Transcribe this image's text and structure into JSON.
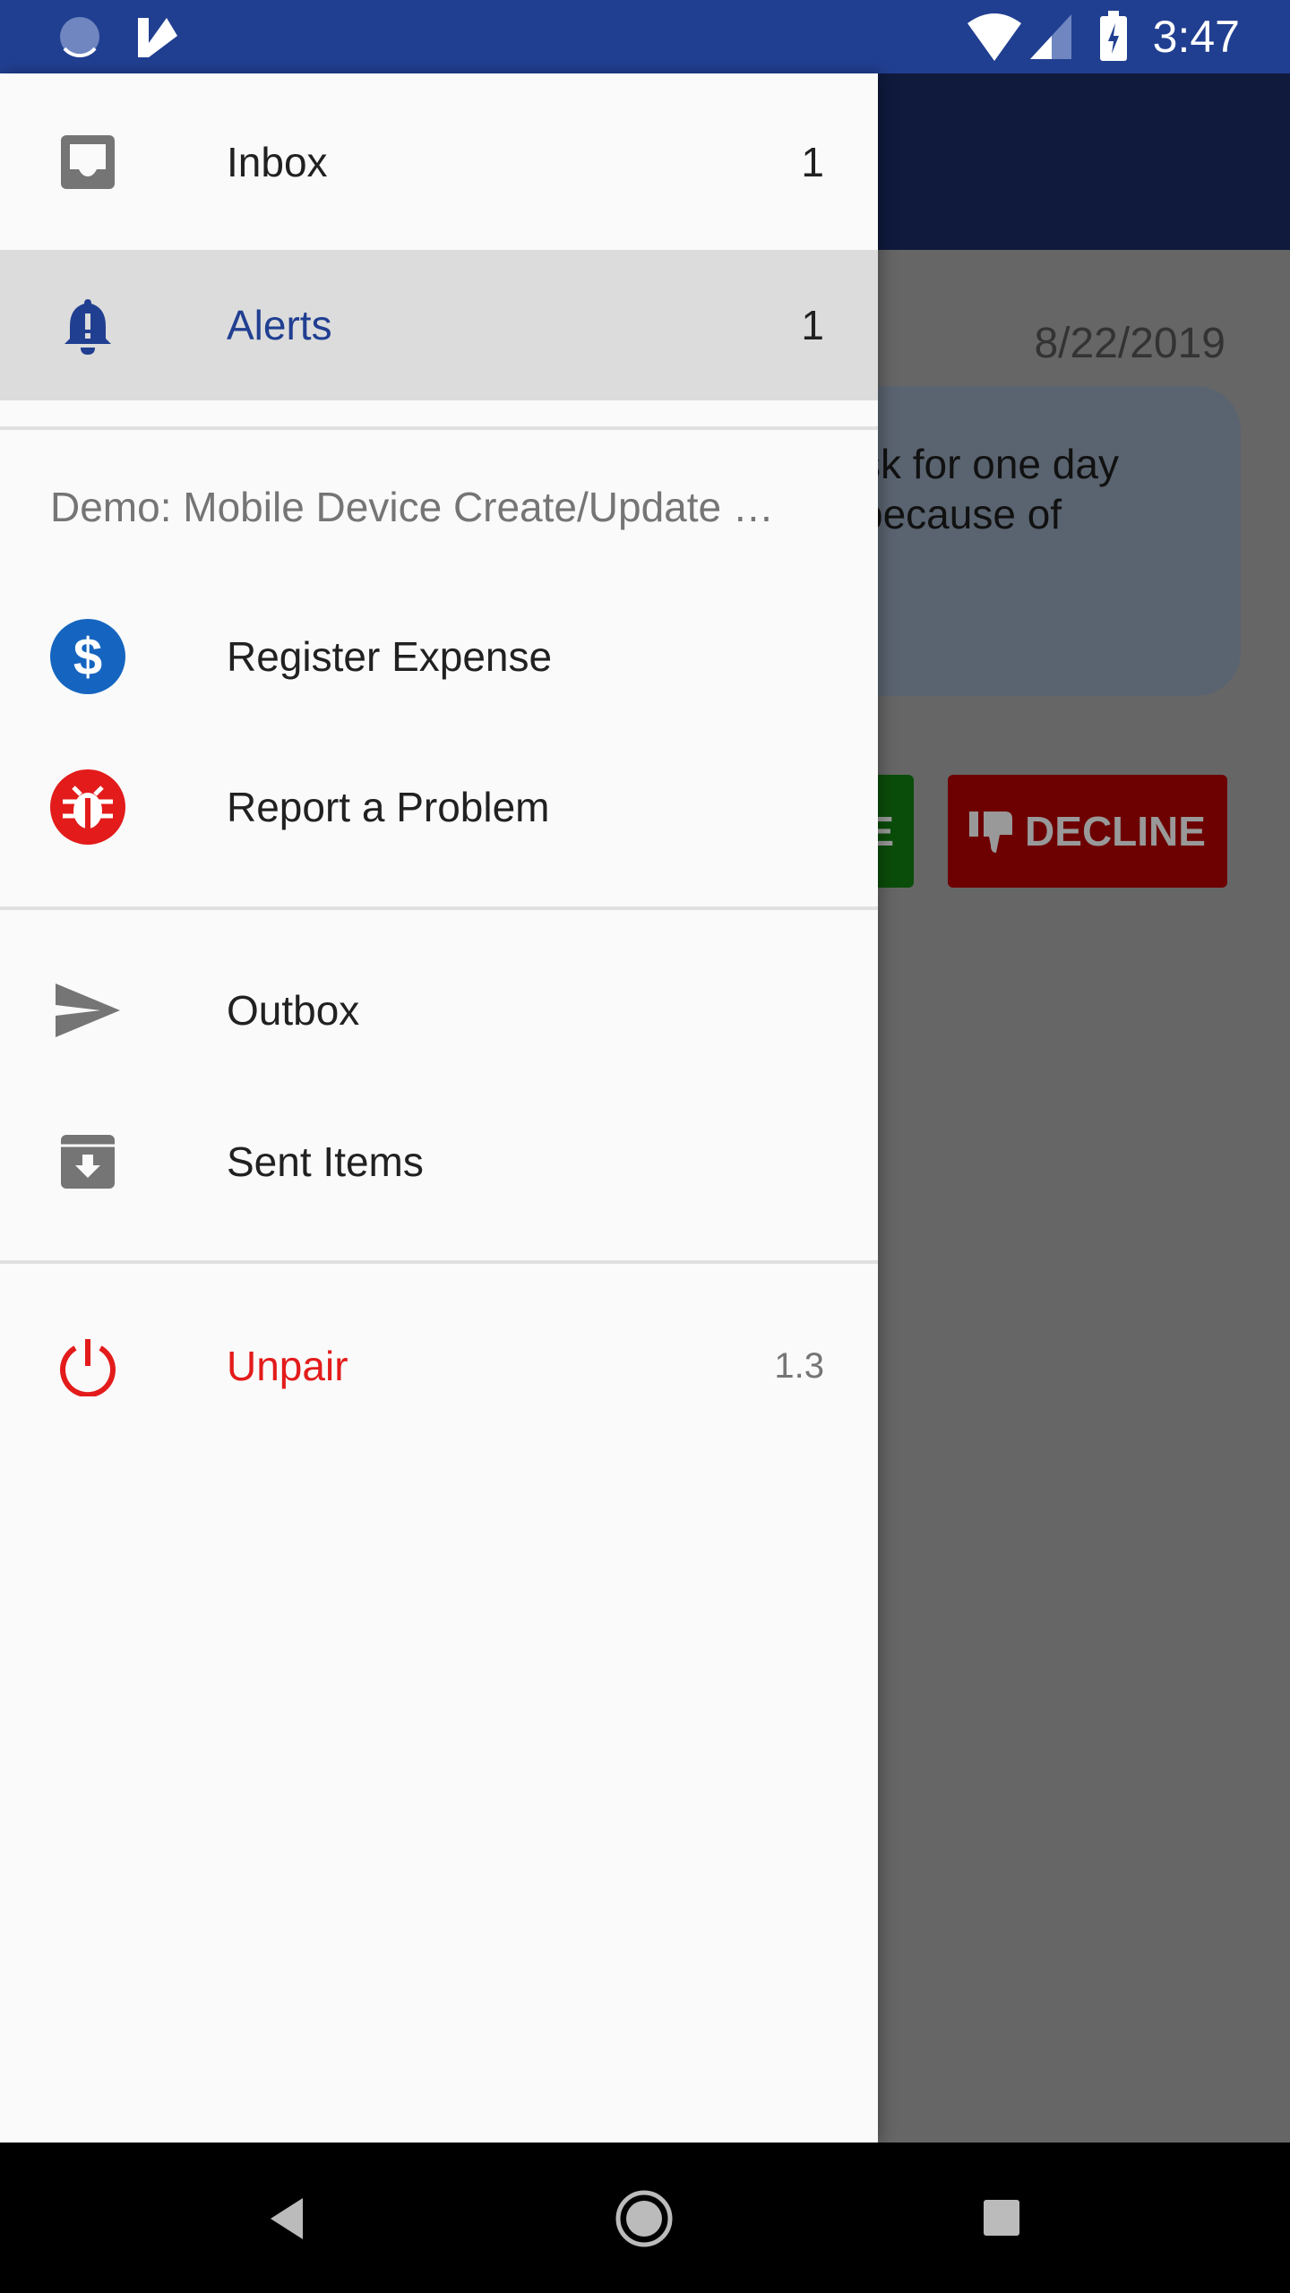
{
  "status_bar": {
    "time": "3:47",
    "icons": [
      "sync-icon",
      "app-check-icon",
      "wifi-icon",
      "signal-icon",
      "battery-charging-icon"
    ]
  },
  "background": {
    "date": "8/22/2019",
    "message_lines": [
      "sk for one day",
      "because of"
    ],
    "approve_fragment": "E",
    "decline_label": "DECLINE"
  },
  "drawer": {
    "inbox": {
      "label": "Inbox",
      "count": "1"
    },
    "alerts": {
      "label": "Alerts",
      "count": "1"
    },
    "section_title": "Demo: Mobile Device Create/Update …",
    "register_expense": {
      "label": "Register Expense"
    },
    "report_problem": {
      "label": "Report a Problem"
    },
    "outbox": {
      "label": "Outbox"
    },
    "sent_items": {
      "label": "Sent Items"
    },
    "unpair": {
      "label": "Unpair",
      "version": "1.3"
    }
  },
  "colors": {
    "accent": "#213f91",
    "danger": "#e31b1b",
    "selected_bg": "#dcdcdc"
  }
}
